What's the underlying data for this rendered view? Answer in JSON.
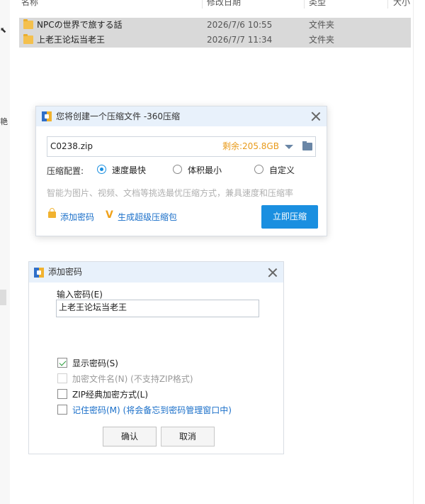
{
  "explorer": {
    "columns": {
      "name": "名称",
      "modified": "修改日期",
      "type": "类型",
      "size": "大小"
    },
    "left_edge_text": "艳",
    "files": [
      {
        "name": "NPCの世界で旅する話",
        "modified": "2026/7/6 10:55",
        "type": "文件夹"
      },
      {
        "name": "上老王论坛当老王",
        "modified": "2026/7/7 11:34",
        "type": "文件夹"
      }
    ]
  },
  "compress_dialog": {
    "title": "您将创建一个压缩文件 -360压缩",
    "filename": "C0238.zip",
    "remaining": "剩余:205.8GB",
    "config_label": "压缩配置:",
    "options": [
      {
        "label": "速度最快",
        "selected": true
      },
      {
        "label": "体积最小",
        "selected": false
      },
      {
        "label": "自定义",
        "selected": false
      }
    ],
    "hint": "智能为图片、视频、文档等挑选最优压缩方式，兼具速度和压缩率",
    "add_password_link": "添加密码",
    "super_pack_link": "生成超级压缩包",
    "compress_button": "立即压缩"
  },
  "password_dialog": {
    "title": "添加密码",
    "input_label": "输入密码(E)",
    "password_value": "上老王论坛当老王",
    "checkboxes": [
      {
        "label": "显示密码(S)",
        "checked": true,
        "enabled": true
      },
      {
        "label": "加密文件名(N) (不支持ZIP格式)",
        "checked": false,
        "enabled": false
      },
      {
        "label": "ZIP经典加密方式(L)",
        "checked": false,
        "enabled": true
      },
      {
        "label": "记住密码(M) (将会备忘到密码管理窗口中)",
        "checked": false,
        "enabled": true
      }
    ],
    "ok_button": "确认",
    "cancel_button": "取消"
  }
}
